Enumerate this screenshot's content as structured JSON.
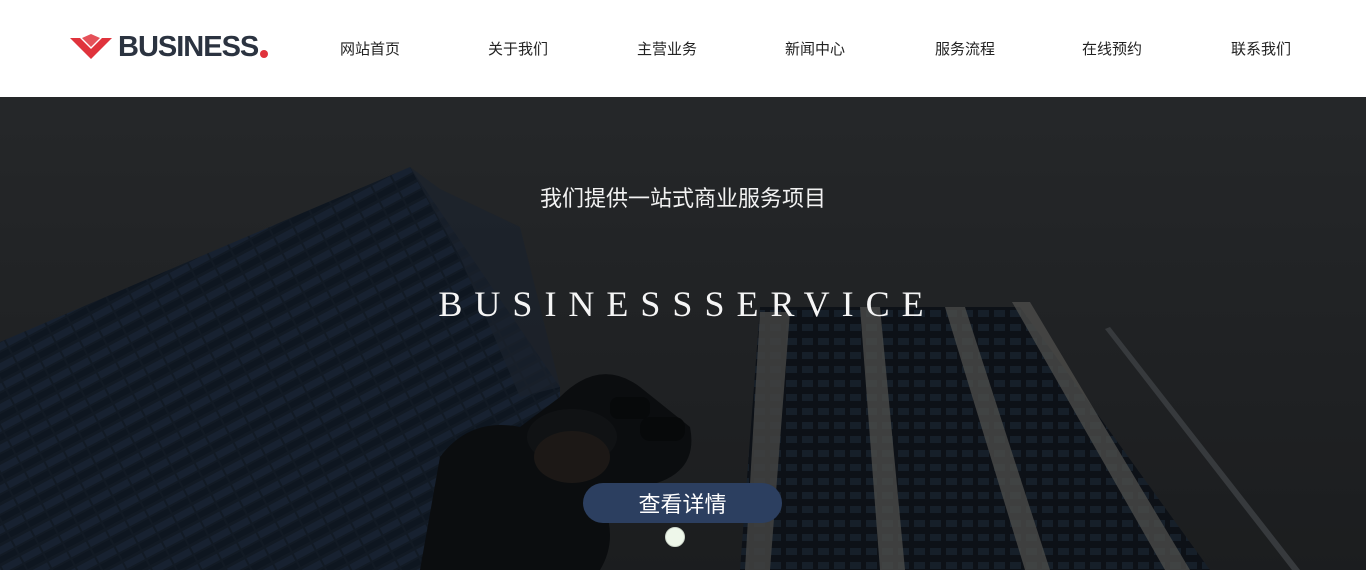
{
  "brand": {
    "name": "BUSINESS",
    "accent_color": "#e0333c",
    "text_color": "#2b3340"
  },
  "nav": {
    "items": [
      {
        "label": "网站首页"
      },
      {
        "label": "关于我们"
      },
      {
        "label": "主营业务"
      },
      {
        "label": "新闻中心"
      },
      {
        "label": "服务流程"
      },
      {
        "label": "在线预约"
      },
      {
        "label": "联系我们"
      }
    ]
  },
  "hero": {
    "subtitle": "我们提供一站式商业服务项目",
    "title": "BUSINESSSERVICE",
    "button_label": "查看详情",
    "button_color": "#2c3f60",
    "slides": [
      {
        "active": true
      }
    ]
  }
}
